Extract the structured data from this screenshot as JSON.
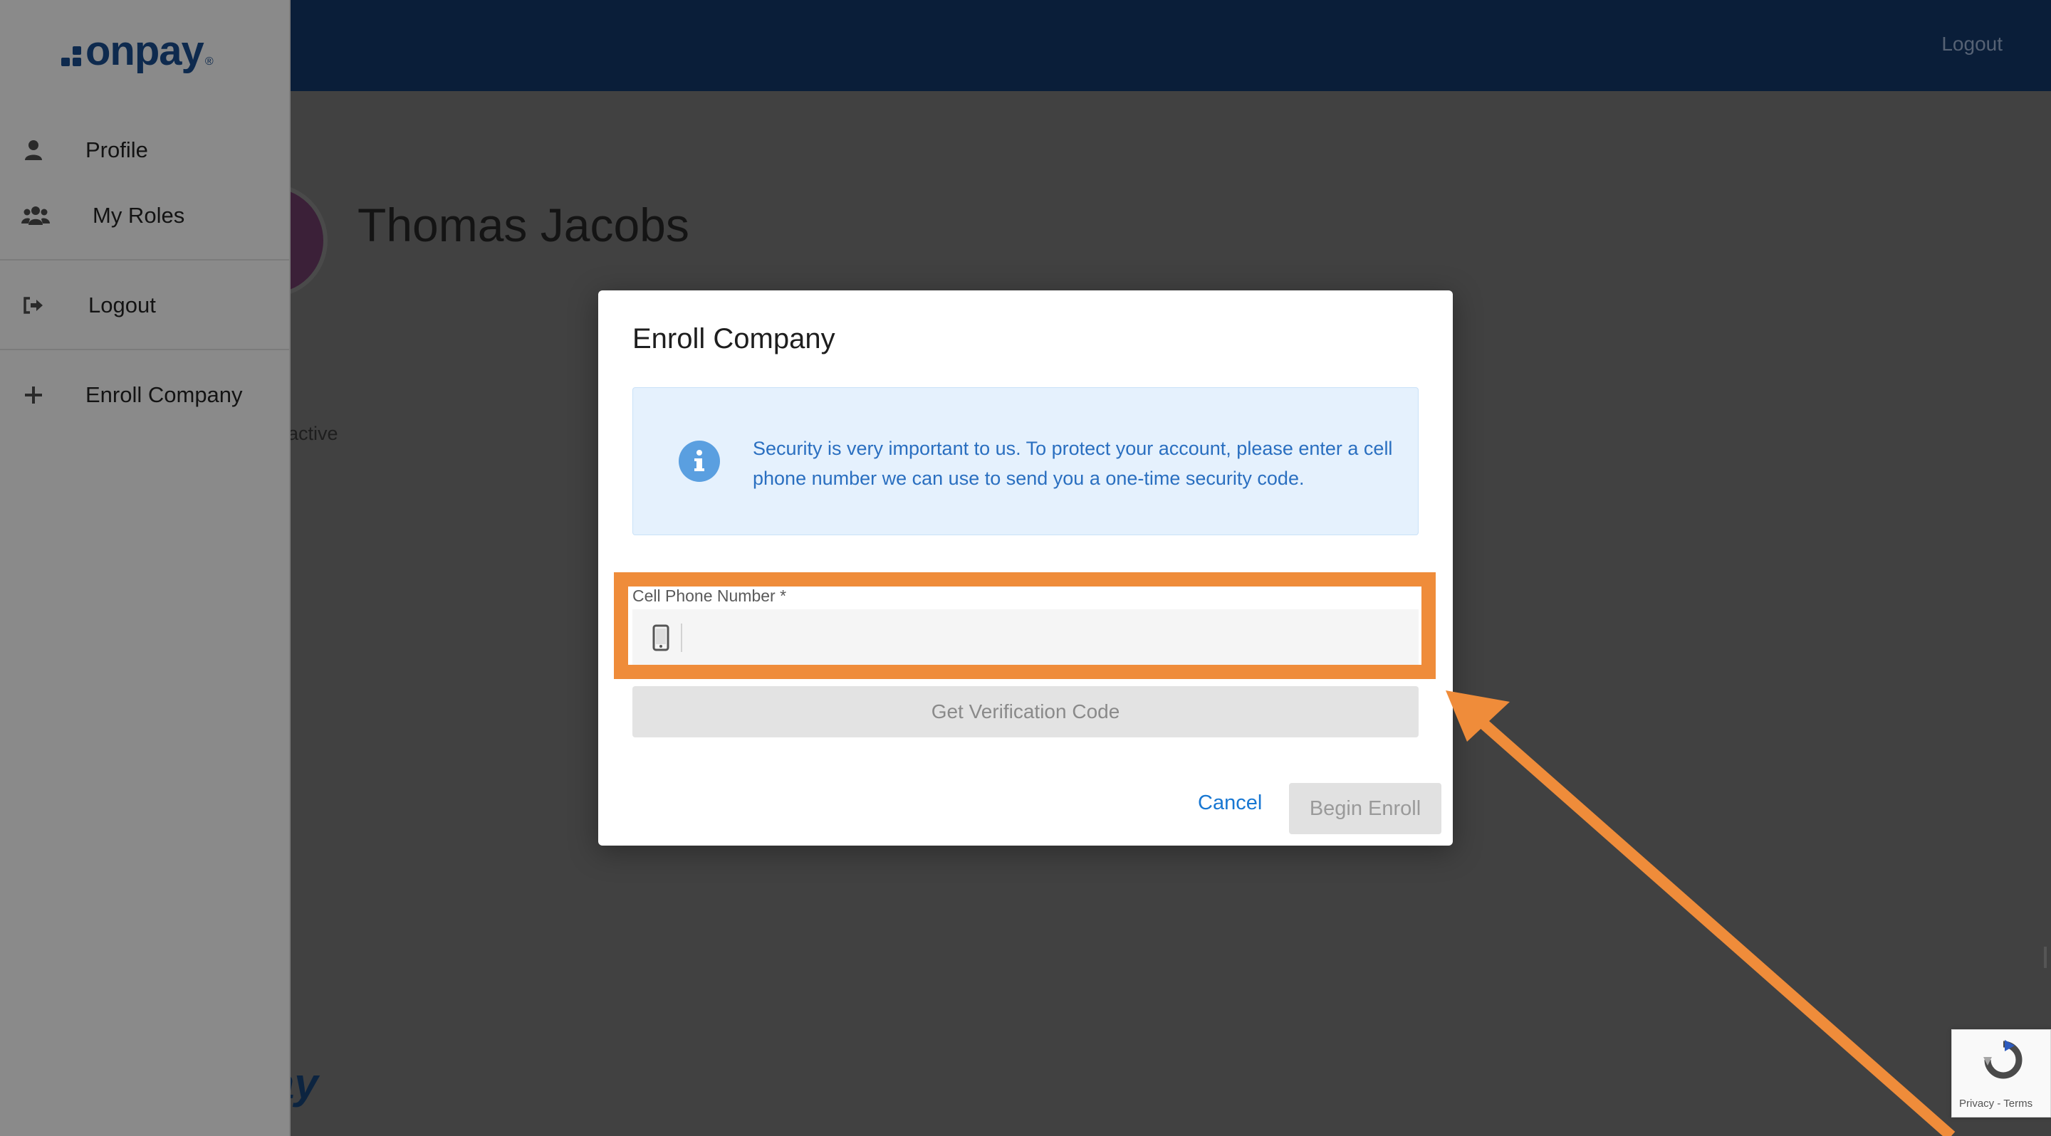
{
  "header": {
    "logout_label": "Logout"
  },
  "background": {
    "user_name": "Thomas Jacobs",
    "status_text": "active",
    "footer_logo_text": "ay"
  },
  "sidebar": {
    "logo_text": "onpay",
    "logo_mark": "®",
    "items": [
      {
        "label": "Profile",
        "icon": "user-icon"
      },
      {
        "label": "My Roles",
        "icon": "users-icon"
      },
      {
        "label": "Logout",
        "icon": "sign-out-icon"
      },
      {
        "label": "Enroll Company",
        "icon": "plus-icon"
      }
    ]
  },
  "modal": {
    "title": "Enroll Company",
    "info_text": "Security is very important to us. To protect your account, please enter a cell phone number we can use to send you a one-time security code.",
    "phone_label": "Cell Phone Number *",
    "phone_value": "",
    "verify_button": "Get Verification Code",
    "cancel_button": "Cancel",
    "begin_button": "Begin Enroll"
  },
  "recaptcha": {
    "links": "Privacy - Terms"
  },
  "colors": {
    "brand_navy": "#0a1e39",
    "highlight_orange": "#ef8c3a",
    "link_blue": "#1877d2",
    "info_blue": "#2a6fc0"
  }
}
